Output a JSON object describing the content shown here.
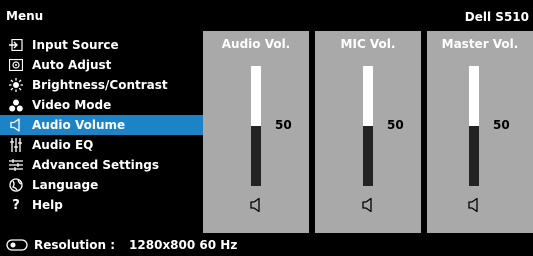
{
  "header": {
    "title": "Menu",
    "model": "Dell S510"
  },
  "sidebar": {
    "items": [
      {
        "label": "Input Source",
        "icon": "input-source-icon",
        "selected": false
      },
      {
        "label": "Auto Adjust",
        "icon": "auto-adjust-icon",
        "selected": false
      },
      {
        "label": "Brightness/Contrast",
        "icon": "brightness-icon",
        "selected": false
      },
      {
        "label": "Video Mode",
        "icon": "video-mode-icon",
        "selected": false
      },
      {
        "label": "Audio Volume",
        "icon": "speaker-icon",
        "selected": true
      },
      {
        "label": "Audio EQ",
        "icon": "equalizer-icon",
        "selected": false
      },
      {
        "label": "Advanced Settings",
        "icon": "sliders-icon",
        "selected": false
      },
      {
        "label": "Language",
        "icon": "globe-icon",
        "selected": false
      },
      {
        "label": "Help",
        "icon": "help-icon",
        "selected": false
      }
    ],
    "selected_color": "#1c84c6"
  },
  "panels": [
    {
      "title": "Audio Vol.",
      "value": "50",
      "level": 0.5
    },
    {
      "title": "MIC Vol.",
      "value": "50",
      "level": 0.5
    },
    {
      "title": "Master Vol.",
      "value": "50",
      "level": 0.5
    }
  ],
  "status": {
    "label": "Resolution :",
    "value": "1280x800 60 Hz",
    "icon": "display-icon"
  }
}
